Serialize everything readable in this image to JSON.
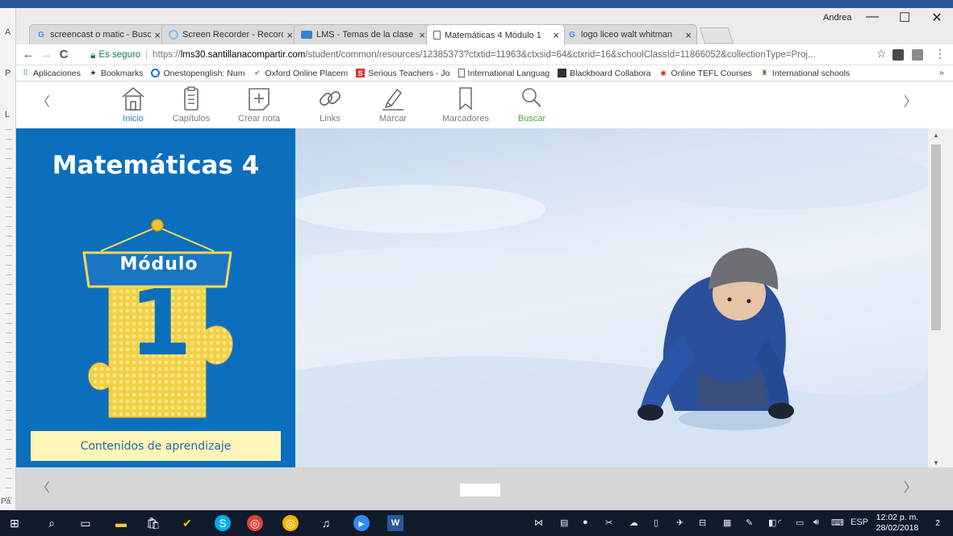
{
  "browser": {
    "user_name": "Andrea",
    "tabs": [
      {
        "label": "screencast o matic - Busc",
        "favicon": "google-icon"
      },
      {
        "label": "Screen Recorder - Record",
        "favicon": "record-icon"
      },
      {
        "label": "LMS - Temas de la clase",
        "favicon": "lms-icon"
      },
      {
        "label": "Matemáticas 4 Módulo 1",
        "favicon": "document-icon",
        "active": true
      },
      {
        "label": "logo liceo walt whitman",
        "favicon": "google-icon"
      }
    ],
    "tab_close": "×",
    "window_controls": {
      "minimize": "—",
      "maximize": "☐",
      "close": "✕"
    },
    "nav": {
      "back": "←",
      "forward": "→",
      "reload": "C"
    },
    "address": {
      "secure_label": "Es seguro",
      "protocol": "https://",
      "host": "lms30.santillanacompartir.com",
      "path": "/student/common/resources/12385373?ctxtid=11963&ctxsid=64&ctxrid=16&schoolClassId=11866052&collectionType=Proj..."
    },
    "toolbar_right": {
      "star": "☆",
      "menu": "⋮"
    },
    "bookmarks": [
      {
        "label": "Aplicaciones",
        "icon": "apps-grid-icon"
      },
      {
        "label": "Bookmarks",
        "icon": "star-icon"
      },
      {
        "label": "Onestopenglish: Num",
        "icon": "onestop-icon"
      },
      {
        "label": "Oxford Online Placem",
        "icon": "oxford-icon"
      },
      {
        "label": "Serious Teachers - Jo",
        "icon": "serious-teachers-icon"
      },
      {
        "label": "International Languag",
        "icon": "page-icon"
      },
      {
        "label": "Blackboard Collabora",
        "icon": "blackboard-icon"
      },
      {
        "label": "Online TEFL Courses",
        "icon": "tefl-icon"
      },
      {
        "label": "International schools",
        "icon": "school-icon"
      }
    ],
    "bookmarks_more": "»"
  },
  "word_bg": {
    "letter_top": "A",
    "letter_p": "P",
    "letter_l": "L",
    "page_label": "Pá"
  },
  "reader": {
    "toolbar": [
      {
        "label": "Inicio",
        "icon": "home-icon"
      },
      {
        "label": "Capítulos",
        "icon": "chapters-icon"
      },
      {
        "label": "Crear nota",
        "icon": "add-note-icon"
      },
      {
        "label": "Links",
        "icon": "link-icon"
      },
      {
        "label": "Marcar",
        "icon": "highlighter-icon"
      },
      {
        "label": "Marcadores",
        "icon": "bookmark-icon"
      },
      {
        "label": "Buscar",
        "icon": "search-icon"
      }
    ],
    "prev": "‹",
    "next": "›",
    "cover": {
      "title": "Matemáticas 4",
      "module_label": "Módulo",
      "module_number": "1",
      "contents_button": "Contenidos de aprendizaje"
    },
    "colors": {
      "cover_blue": "#0b6fbe",
      "puzzle_yellow": "#f6d85a",
      "contents_bg": "#fff5b8"
    }
  },
  "taskbar": {
    "language": "ESP",
    "time": "12:02 p. m.",
    "date": "28/02/2018",
    "notification_count": "2"
  }
}
